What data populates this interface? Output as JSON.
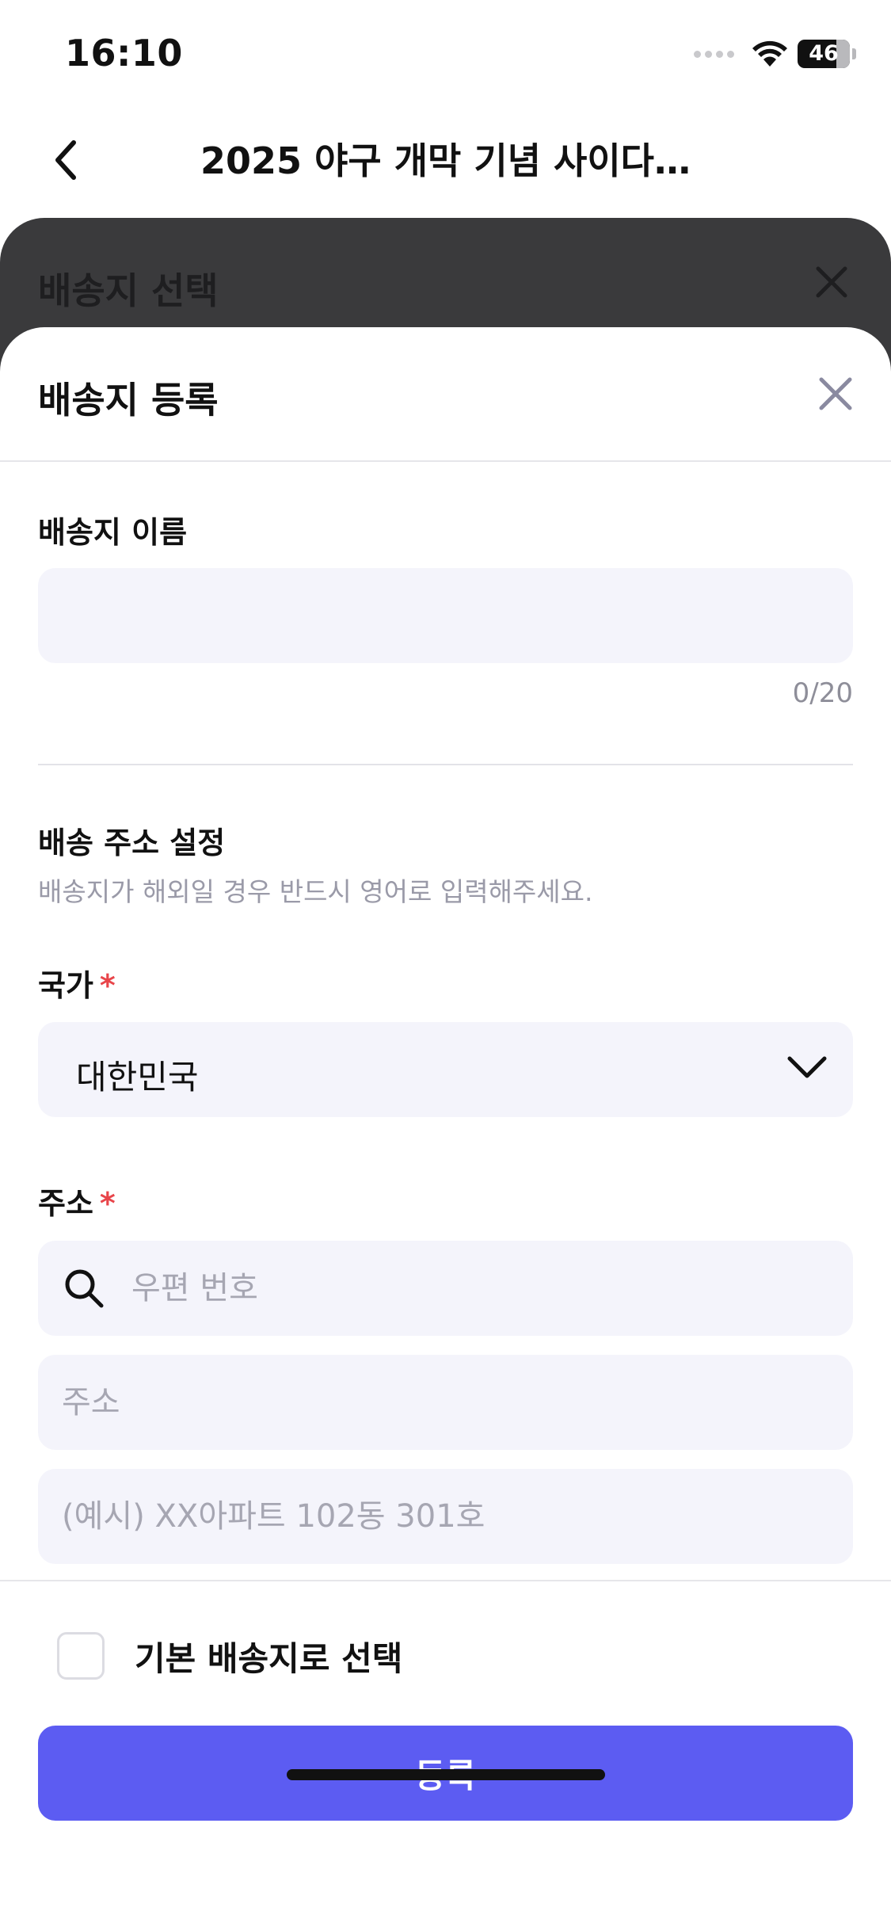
{
  "status_bar": {
    "time": "16:10",
    "battery_level": "46",
    "icons": [
      "cellular-signal-icon",
      "wifi-icon",
      "battery-icon"
    ]
  },
  "nav": {
    "title": "2025 야구 개막 기념 사이다…",
    "back_icon": "chevron-left-icon"
  },
  "background_sheet": {
    "title": "배송지 선택",
    "close_icon": "close-icon"
  },
  "modal": {
    "title": "배송지 등록",
    "close_icon": "close-icon",
    "name_section": {
      "label": "배송지 이름",
      "value": "",
      "placeholder": "",
      "counter": "0/20"
    },
    "address_section": {
      "title": "배송 주소 설정",
      "helper": "배송지가 해외일 경우 반드시 영어로 입력해주세요.",
      "country_label": "국가",
      "required_mark": "*",
      "country_value": "대한민국",
      "address_label": "주소",
      "postal_placeholder": "우편 번호",
      "address_placeholder": "주소",
      "detail_placeholder": "(예시) XX아파트 102동 301호"
    },
    "default_checkbox_label": "기본 배송지로 선택",
    "default_checked": false,
    "submit_label": "등록"
  },
  "colors": {
    "primary": "#5c5cf2",
    "field_bg": "#f4f4fb",
    "required": "#e8454a",
    "dim_overlay": "#3a3a3c",
    "helper_text": "#9a9aa8"
  }
}
